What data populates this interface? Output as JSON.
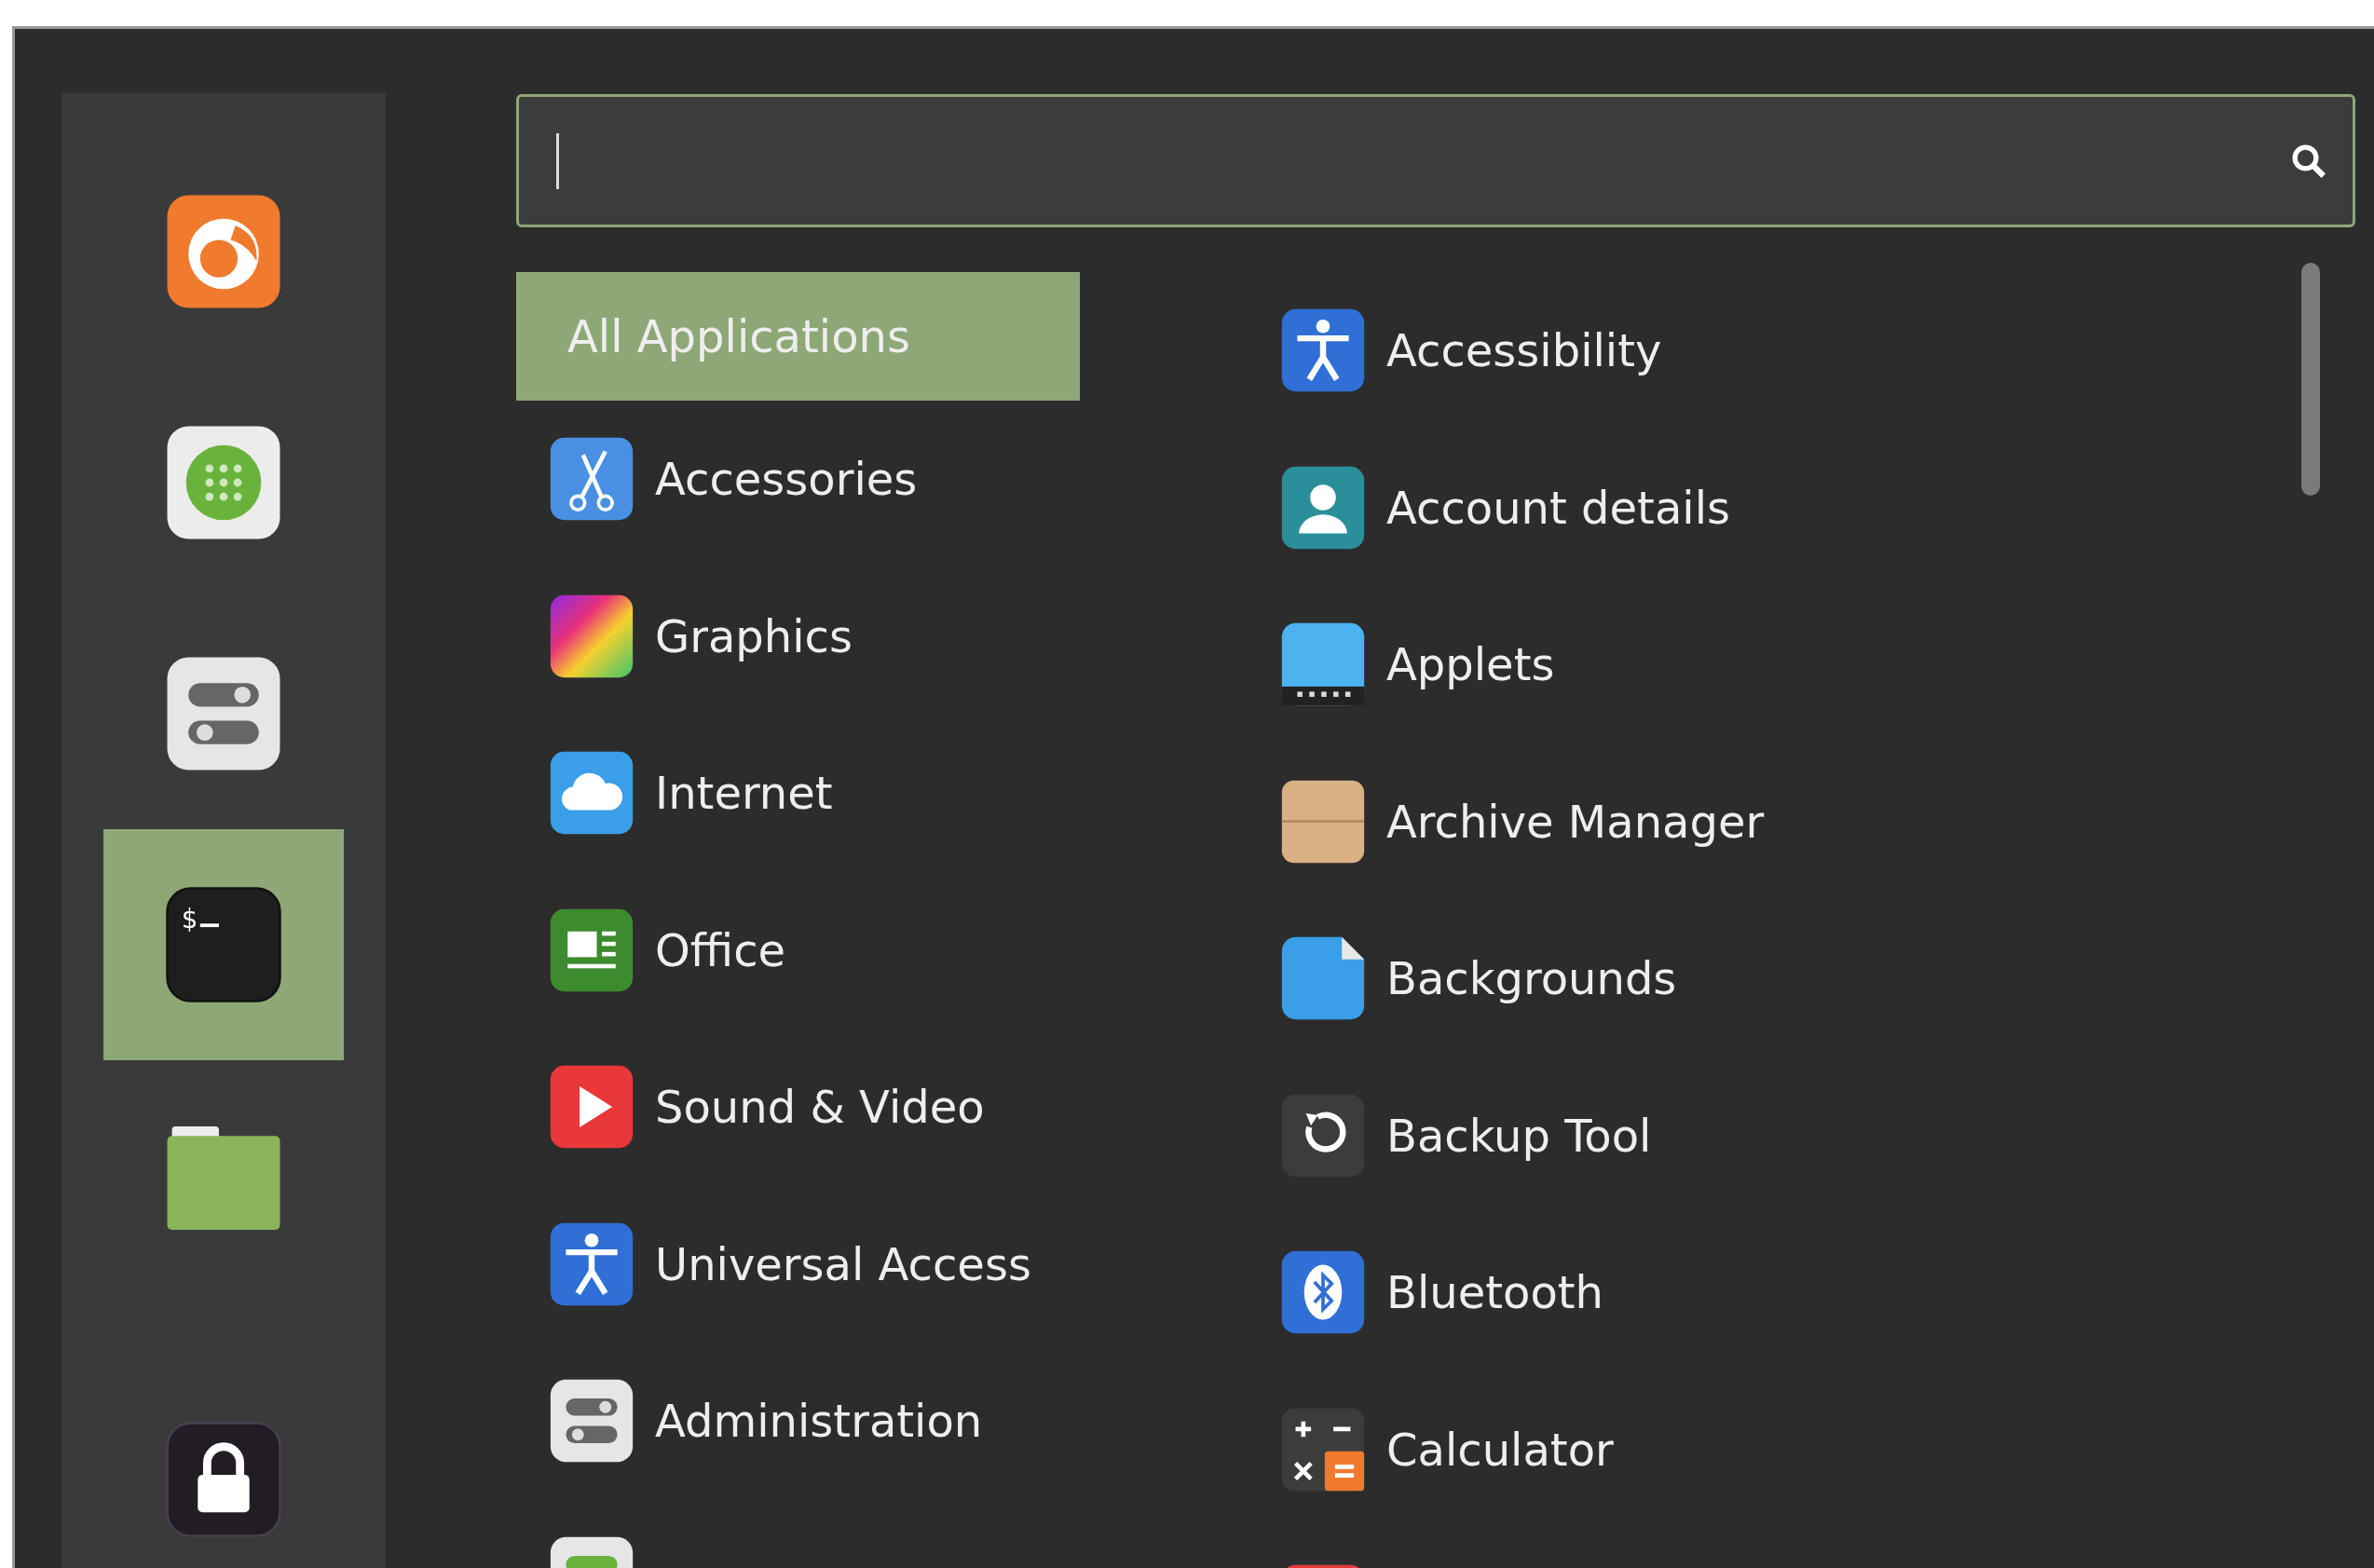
{
  "sidebar": {
    "favorites": [
      {
        "kind": "browser",
        "selected": false
      },
      {
        "kind": "software",
        "selected": false
      },
      {
        "kind": "settings",
        "selected": false
      },
      {
        "kind": "terminal",
        "glyph": "$",
        "selected": true
      },
      {
        "kind": "folder",
        "selected": false
      }
    ],
    "session": [
      {
        "kind": "lock",
        "selected": false
      }
    ]
  },
  "categories": [
    {
      "label": "All Applications",
      "kind": "none",
      "selected": true
    },
    {
      "label": "Accessories",
      "kind": "scissors",
      "selected": false
    },
    {
      "label": "Graphics",
      "kind": "rainbow",
      "selected": false
    },
    {
      "label": "Internet",
      "kind": "cloud",
      "selected": false
    },
    {
      "label": "Office",
      "kind": "document",
      "selected": false
    },
    {
      "label": "Sound & Video",
      "kind": "play",
      "selected": false
    },
    {
      "label": "Universal Access",
      "kind": "person",
      "selected": false
    },
    {
      "label": "Administration",
      "kind": "toggles",
      "selected": false
    },
    {
      "kind": "green-toggles",
      "selected": false
    }
  ],
  "applications": [
    {
      "label": "Accessibility",
      "kind": "person"
    },
    {
      "label": "Account details",
      "kind": "account"
    },
    {
      "label": "Applets",
      "kind": "applets"
    },
    {
      "label": "Archive Manager",
      "kind": "box"
    },
    {
      "label": "Backgrounds",
      "kind": "page"
    },
    {
      "label": "Backup Tool",
      "kind": "backup"
    },
    {
      "label": "Bluetooth",
      "kind": "bluetooth"
    },
    {
      "label": "Calculator",
      "kind": "calculator"
    },
    {
      "kind": "red"
    }
  ]
}
